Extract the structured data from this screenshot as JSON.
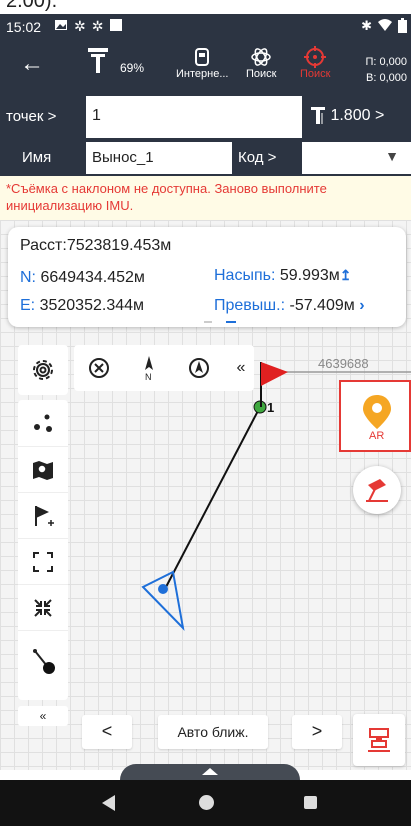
{
  "crop_text": "2.00).",
  "status_bar": {
    "time": "15:02"
  },
  "toolbar": {
    "battery_pct": "69%",
    "internet_label": "Интерне...",
    "search_label": "Поиск",
    "search_red_label": "Поиск",
    "p_value": "П: 0,000",
    "b_value": "В: 0,000"
  },
  "point_row": {
    "label": "точек >",
    "value": "1",
    "height": "1.800 >"
  },
  "name_row": {
    "label": "Имя",
    "value": "Вынос_1",
    "code_label": "Код >"
  },
  "warning": "*Съёмка с наклоном не доступна. Заново выполните инициализацию IMU.",
  "info": {
    "distance": "Расст:7523819.453м",
    "n_key": "N:",
    "n_value": "6649434.452м",
    "e_key": "E:",
    "e_value": "3520352.344м",
    "fill_key": "Насыпь:",
    "fill_value": "59.993м",
    "excess_key": "Превыш.:",
    "excess_value": "-57.409м"
  },
  "map": {
    "target_label": "4639688",
    "point_label": "1",
    "ar_label": "AR"
  },
  "nav": {
    "prev": "<",
    "mode": "Авто ближ.",
    "next": ">"
  },
  "colors": {
    "bar": "#2c3442",
    "accent_blue": "#1e6fd9",
    "red": "#e53935",
    "orange": "#f5a623"
  }
}
